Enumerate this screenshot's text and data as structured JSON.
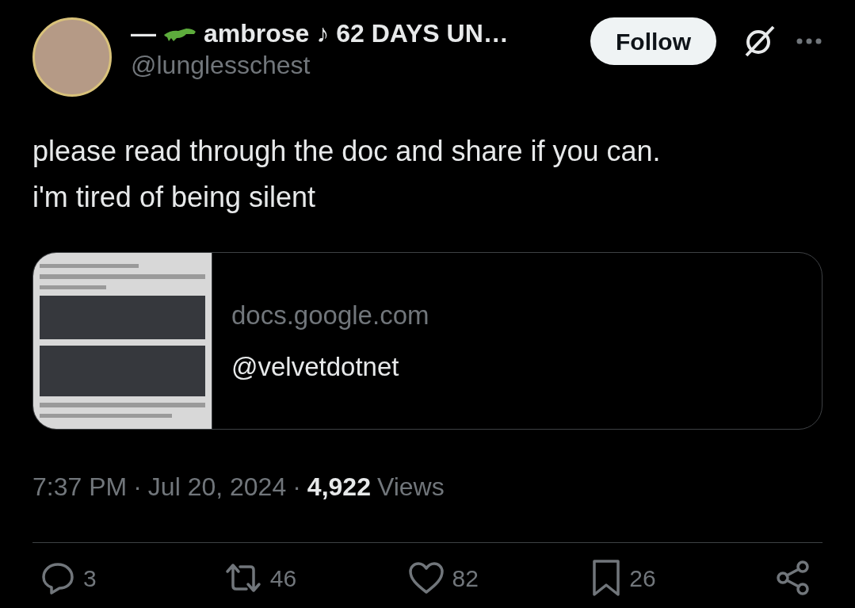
{
  "author": {
    "name_prefix": "—",
    "name": "ambrose ♪ 62 DAYS UN…",
    "handle": "@lunglesschest",
    "follow_label": "Follow"
  },
  "tweet": {
    "lines": [
      "please read through the doc and share if you can.",
      "i'm tired of being silent"
    ]
  },
  "link_card": {
    "domain": "docs.google.com",
    "author": "@velvetdotnet"
  },
  "meta": {
    "time": "7:37 PM",
    "separator": "·",
    "date": "Jul 20, 2024",
    "separator_2": "·",
    "views_count": "4,922",
    "views_label": "Views"
  },
  "actions": [
    {
      "kind": "reply",
      "count": "3"
    },
    {
      "kind": "repost",
      "count": "46"
    },
    {
      "kind": "like",
      "count": "82"
    },
    {
      "kind": "bookmark",
      "count": "26"
    },
    {
      "kind": "share"
    }
  ]
}
